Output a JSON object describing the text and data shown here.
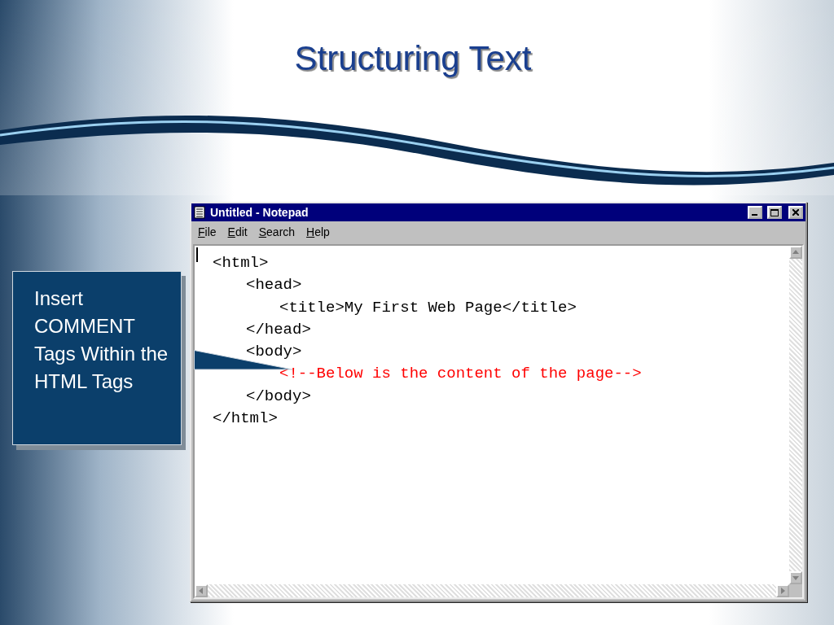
{
  "slide": {
    "title": "Structuring Text"
  },
  "callout": {
    "text": "Insert COMMENT Tags Within the HTML Tags"
  },
  "window": {
    "title": "Untitled - Notepad",
    "menu": [
      {
        "accel": "F",
        "rest": "ile"
      },
      {
        "accel": "E",
        "rest": "dit"
      },
      {
        "accel": "S",
        "rest": "earch"
      },
      {
        "accel": "H",
        "rest": "elp"
      }
    ],
    "lines": [
      {
        "text": "<html>",
        "kind": "tag",
        "children": [
          {
            "text": "<head>",
            "kind": "tag",
            "children": [
              {
                "text": "<title>My First Web Page</title>",
                "kind": "tag"
              }
            ]
          },
          {
            "text": "</head>",
            "kind": "tag"
          },
          {
            "text": "<body>",
            "kind": "tag",
            "children": [
              {
                "text": "<!--Below is the content of the page-->",
                "kind": "comment"
              }
            ]
          },
          {
            "text": "</body>",
            "kind": "tag"
          }
        ]
      },
      {
        "text": "</html>",
        "kind": "tag"
      }
    ]
  }
}
